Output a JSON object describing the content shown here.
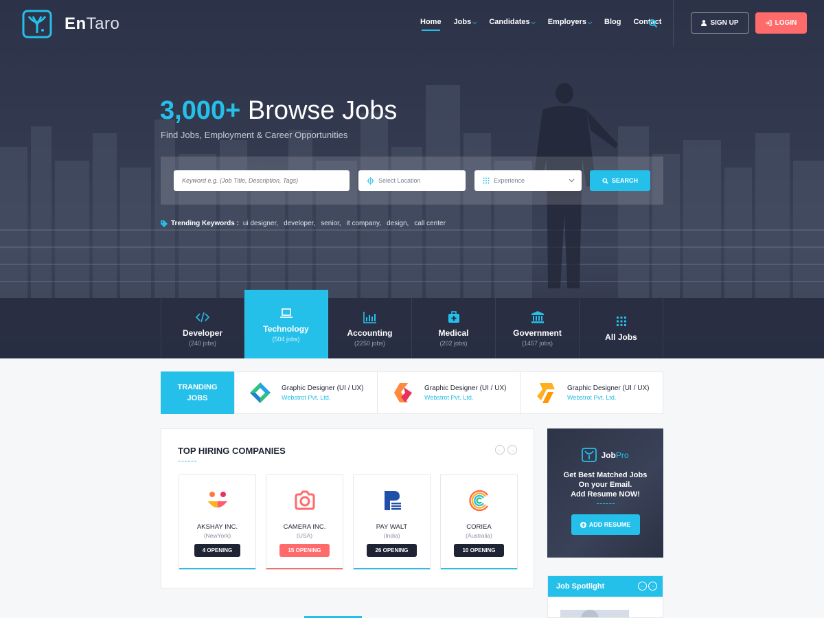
{
  "brand": {
    "name_bold": "En",
    "name_light": "Taro"
  },
  "nav": {
    "items": [
      {
        "label": "Home",
        "dropdown": false,
        "active": true
      },
      {
        "label": "Jobs",
        "dropdown": true,
        "active": false
      },
      {
        "label": "Candidates",
        "dropdown": true,
        "active": false
      },
      {
        "label": "Employers",
        "dropdown": true,
        "active": false
      },
      {
        "label": "Blog",
        "dropdown": false,
        "active": false
      },
      {
        "label": "Contact",
        "dropdown": false,
        "active": false
      }
    ],
    "search_icon": "search-icon",
    "signup_label": "SIGN UP",
    "login_label": "LOGIN"
  },
  "hero": {
    "title_accent": "3,000+",
    "title_rest": " Browse Jobs",
    "subtitle": "Find Jobs, Employment & Career Opportunities"
  },
  "search": {
    "keyword_placeholder": "Keyword e.g. (Job Title, Description, Tags)",
    "location_placeholder": "Select Location",
    "experience_value": "Experience",
    "button_label": "SEARCH"
  },
  "trending": {
    "label": "Trending Keywords :",
    "keywords": [
      "ui designer,",
      "developer,",
      "senior,",
      "it company,",
      "design,",
      "call center"
    ]
  },
  "categories": [
    {
      "name": "Developer",
      "count": "(240 jobs)",
      "icon": "code-icon",
      "active": false
    },
    {
      "name": "Technology",
      "count": "(504 jobs)",
      "icon": "laptop-icon",
      "active": true
    },
    {
      "name": "Accounting",
      "count": "(2250 jobs)",
      "icon": "bar-chart-icon",
      "active": false
    },
    {
      "name": "Medical",
      "count": "(202 jobs)",
      "icon": "medical-kit-icon",
      "active": false
    },
    {
      "name": "Government",
      "count": "(1457 jobs)",
      "icon": "bank-icon",
      "active": false
    },
    {
      "name": "All Jobs",
      "count": "",
      "icon": "grid-icon",
      "active": false
    }
  ],
  "trending_jobs": {
    "label_line1": "TRANDING",
    "label_line2": "JOBS",
    "items": [
      {
        "title": "Graphic Designer (UI / UX)",
        "company": "Webstrot Pvt. Ltd.",
        "logo": "diamond-logo-icon"
      },
      {
        "title": "Graphic Designer (UI / UX)",
        "company": "Webstrot Pvt. Ltd.",
        "logo": "ribbon-logo-icon"
      },
      {
        "title": "Graphic Designer (UI / UX)",
        "company": "Webstrot Pvt. Ltd.",
        "logo": "fold-logo-icon"
      }
    ]
  },
  "top_hiring": {
    "title": "TOP HIRING COMPANIES",
    "companies": [
      {
        "name": "AKSHAY INC.",
        "location": "(NewYork)",
        "openings": "4 OPENING",
        "highlight": false,
        "logo": "smiley-logo-icon"
      },
      {
        "name": "CAMERA INC.",
        "location": "(USA)",
        "openings": "15 OPENING",
        "highlight": true,
        "logo": "camera-logo-icon"
      },
      {
        "name": "PAY WALT",
        "location": "(India)",
        "openings": "26 OPENING",
        "highlight": false,
        "logo": "p-logo-icon"
      },
      {
        "name": "CORIEA",
        "location": "(Australia)",
        "openings": "10 OPENING",
        "highlight": false,
        "logo": "c-logo-icon"
      }
    ]
  },
  "ad": {
    "brand_bold": "Job",
    "brand_light": "Pro",
    "line1": "Get Best Matched Jobs",
    "line2": "On your Email.",
    "line3": "Add Resume NOW!",
    "button_label": "ADD RESUME"
  },
  "spotlight": {
    "title": "Job Spotlight"
  },
  "colors": {
    "accent": "#25c0ea",
    "danger": "#ff6b6b",
    "dark": "#1e2433"
  }
}
